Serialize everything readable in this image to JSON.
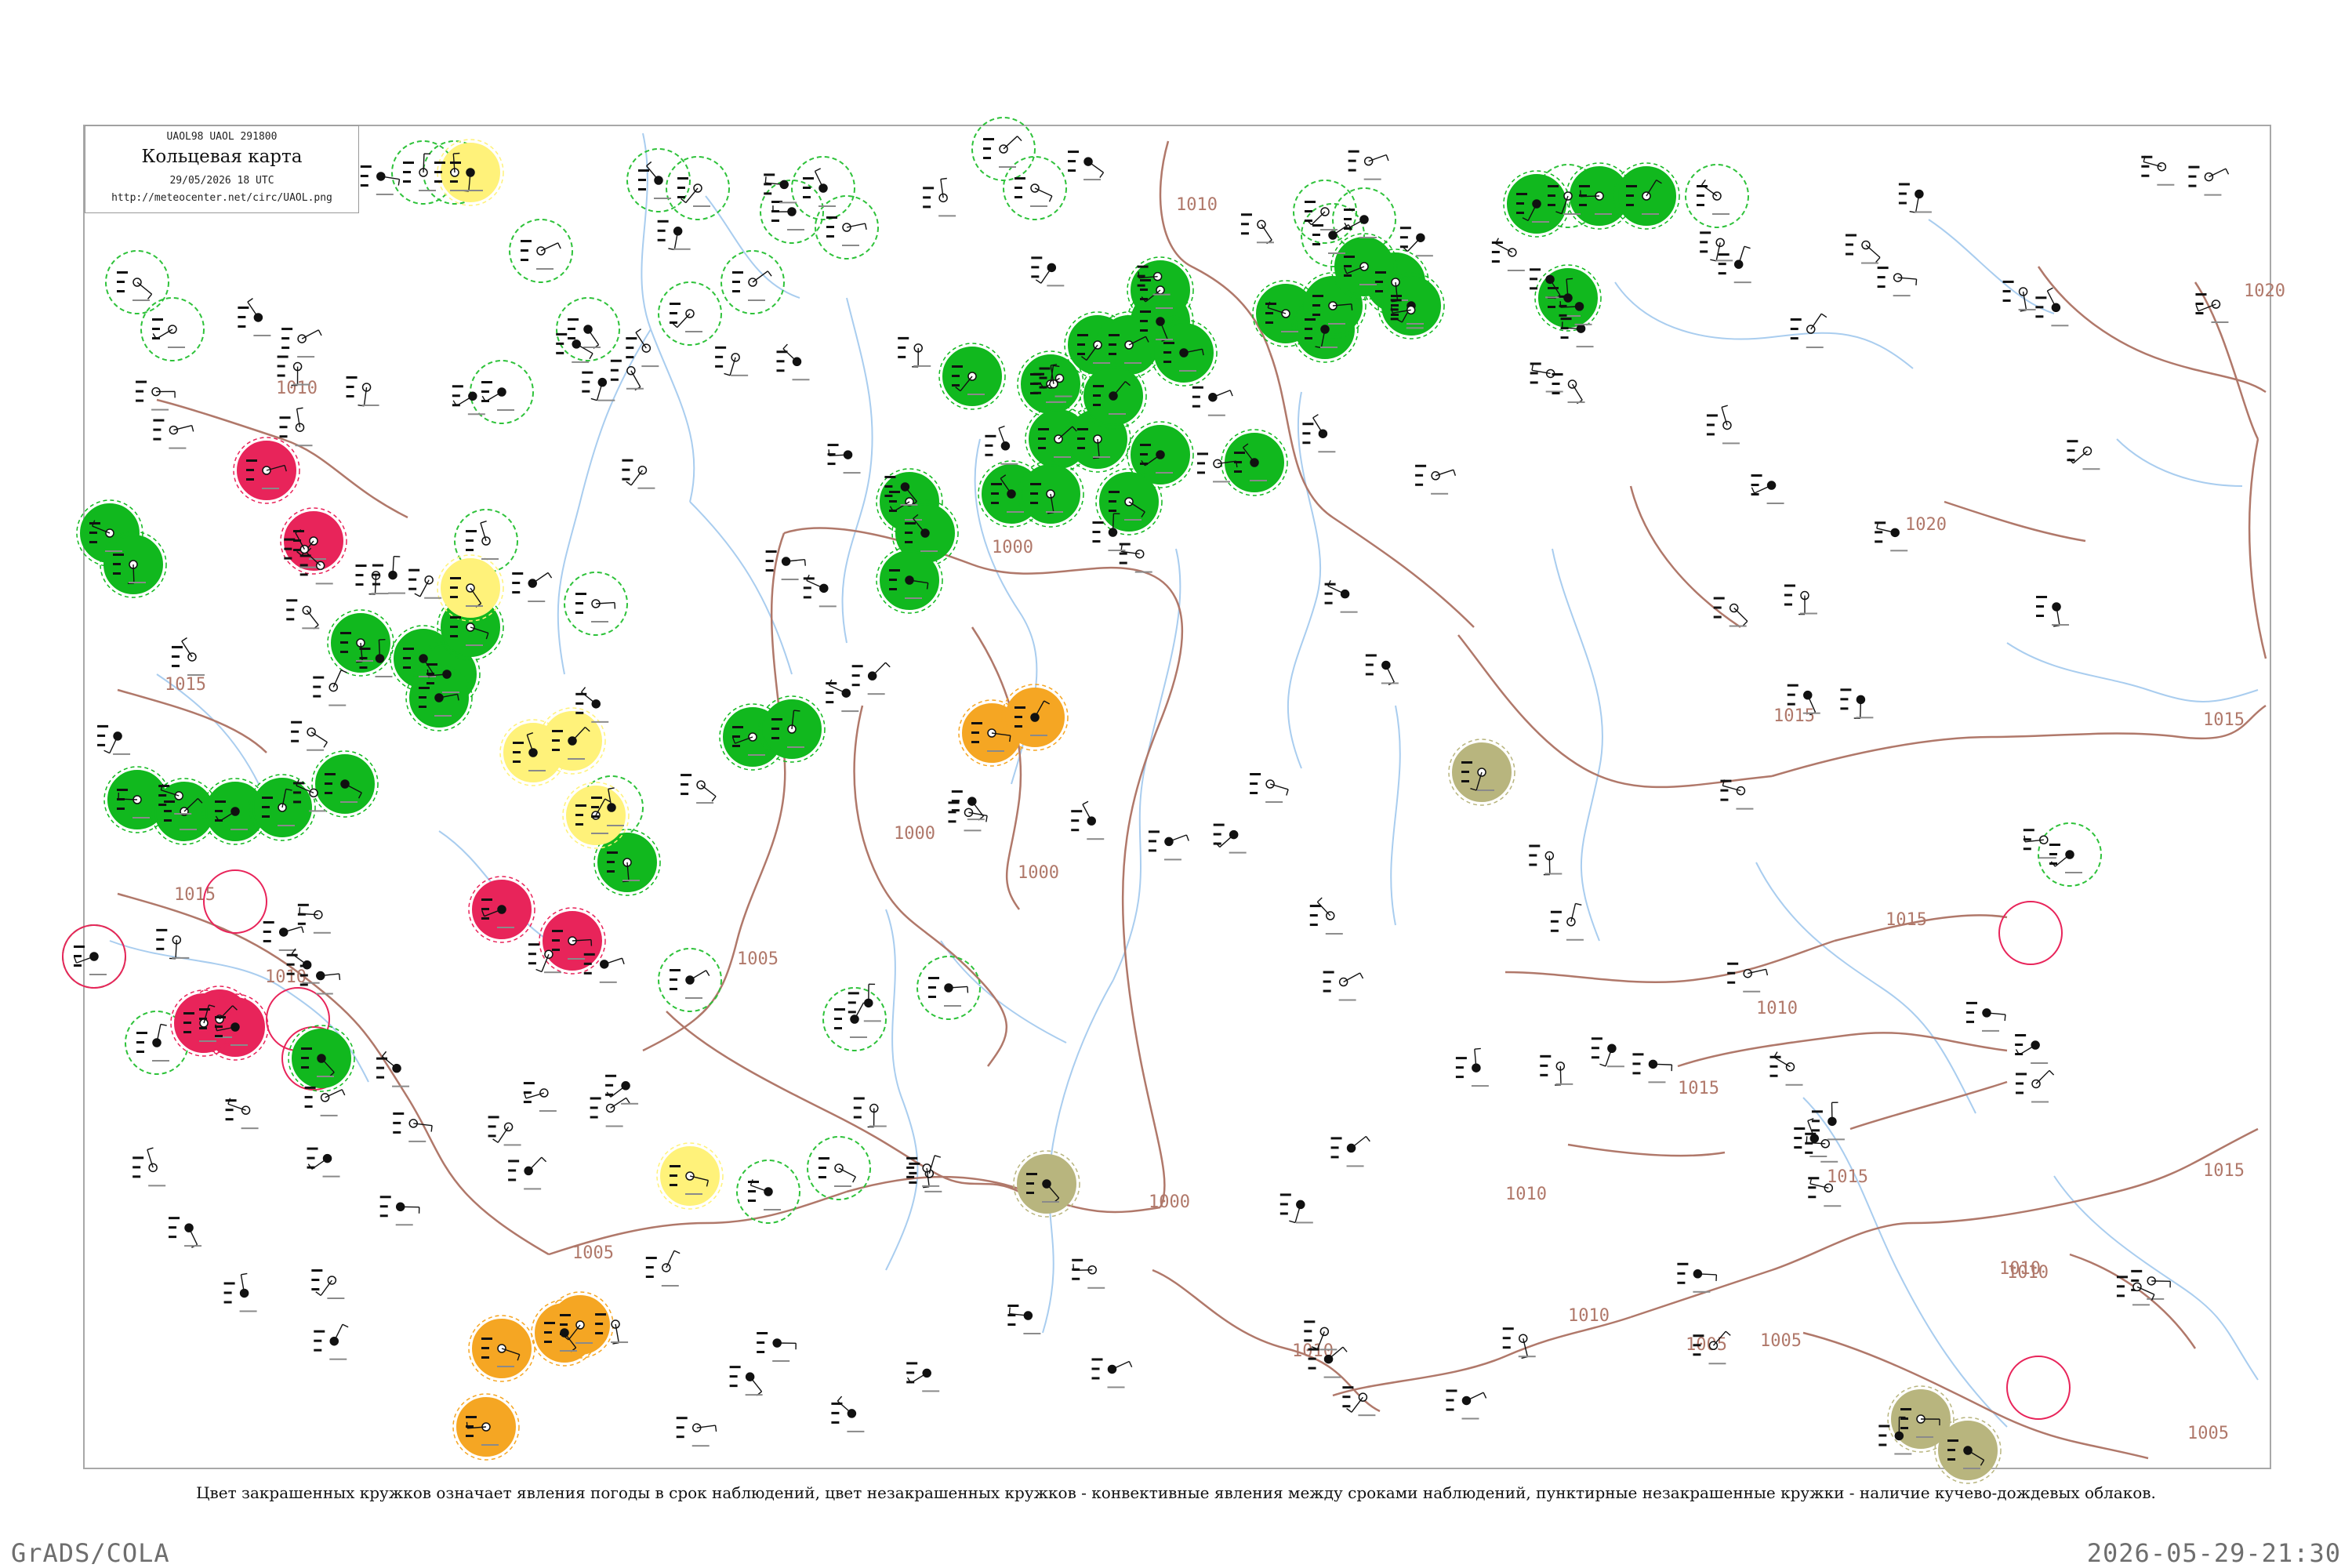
{
  "legend": {
    "codes": "UAOL98  UAOL  291800",
    "title": "Кольцевая карта",
    "datetime": "29/05/2026 18 UTC",
    "url": "http://meteocenter.net/circ/UAOL.png"
  },
  "caption": "Цвет закрашенных кружков означает явления погоды в срок наблюдений, цвет незакрашенных кружков - конвективные явления между сроками наблюдений, пунктирные незакрашенные кружки - наличие кучево-дождевых облаков.",
  "footer": {
    "left": "GrADS/COLA",
    "right": "2026-05-29-21:30"
  },
  "colors": {
    "rain_green": "#11b81e",
    "thunder_red": "#e8245a",
    "fog_yellow": "#fff27a",
    "dust_orange": "#f5a623",
    "haze_olive": "#b8b57e",
    "isobar": "#b0786a",
    "river": "#9ec5ea",
    "outline_green": "#2ec23a",
    "outline_red": "#e8245a"
  },
  "isobar_labels": [
    "1000",
    "1000",
    "1000",
    "1000",
    "1005",
    "1005",
    "1005",
    "1005",
    "1010",
    "1010",
    "1010",
    "1010",
    "1010",
    "1010",
    "1010",
    "1010",
    "1015",
    "1015",
    "1015",
    "1015",
    "1015",
    "1015",
    "1015",
    "1015",
    "1020",
    "1020",
    "1005",
    "1010"
  ],
  "stations": {
    "filled_green": 44,
    "filled_red": 7,
    "filled_yellow": 6,
    "filled_orange": 6,
    "filled_olive": 4
  }
}
